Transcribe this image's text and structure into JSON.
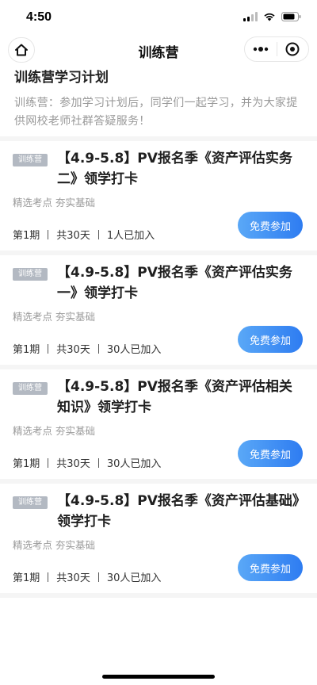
{
  "status": {
    "time": "4:50"
  },
  "nav": {
    "title": "训练营"
  },
  "plan": {
    "title": "训练营学习计划",
    "description": "训练营：参加学习计划后，同学们一起学习，并为大家提供网校老师社群答疑服务！"
  },
  "courses": [
    {
      "tag": "训练营",
      "title": "【4.9-5.8】PV报名季《资产评估实务二》领学打卡",
      "labels": [
        "精选考点",
        "夯实基础"
      ],
      "period": "第1期",
      "duration": "共30天",
      "joined": "1人已加入",
      "button": "免费参加"
    },
    {
      "tag": "训练营",
      "title": "【4.9-5.8】PV报名季《资产评估实务一》领学打卡",
      "labels": [
        "精选考点",
        "夯实基础"
      ],
      "period": "第1期",
      "duration": "共30天",
      "joined": "30人已加入",
      "button": "免费参加"
    },
    {
      "tag": "训练营",
      "title": "【4.9-5.8】PV报名季《资产评估相关知识》领学打卡",
      "labels": [
        "精选考点",
        "夯实基础"
      ],
      "period": "第1期",
      "duration": "共30天",
      "joined": "30人已加入",
      "button": "免费参加"
    },
    {
      "tag": "训练营",
      "title": "【4.9-5.8】PV报名季《资产评估基础》领学打卡",
      "labels": [
        "精选考点",
        "夯实基础"
      ],
      "period": "第1期",
      "duration": "共30天",
      "joined": "30人已加入",
      "button": "免费参加"
    }
  ],
  "icons": {
    "home": "home-icon",
    "more": "more-dots-icon",
    "close": "target-close-icon",
    "signal": "signal-icon",
    "wifi": "wifi-icon",
    "battery": "battery-icon"
  },
  "colors": {
    "accent": "#2e7cf1",
    "tag_bg": "#b3b9c2",
    "muted": "#999999"
  }
}
